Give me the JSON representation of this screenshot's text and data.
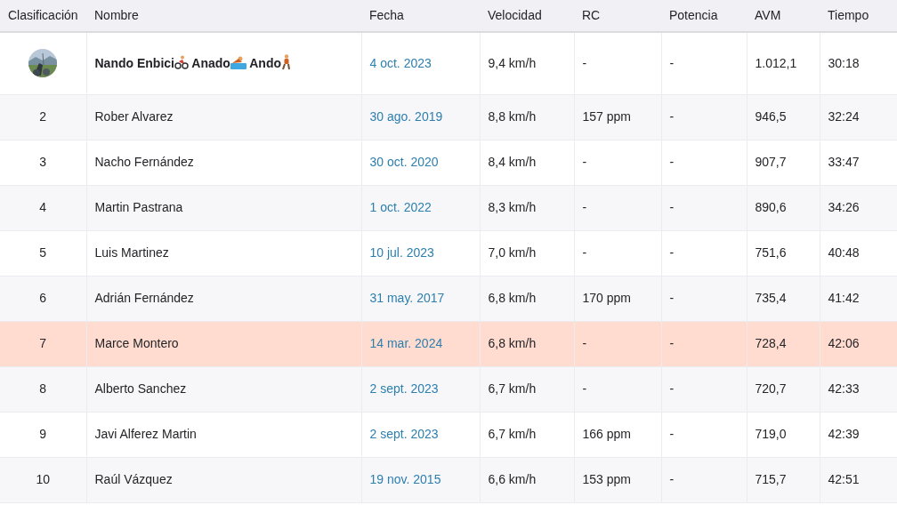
{
  "table": {
    "columns": [
      "Clasificación",
      "Nombre",
      "Fecha",
      "Velocidad",
      "RC",
      "Potencia",
      "AVM",
      "Tiempo"
    ],
    "rows": [
      {
        "name_parts": [
          "Nando Enbici",
          " Anado",
          " Ando"
        ],
        "date": "4 oct. 2023",
        "speed": "9,4 km/h",
        "rc": "-",
        "power": "-",
        "avm": "1.012,1",
        "time": "30:18",
        "highlighted": false
      },
      {
        "rank": "2",
        "name": "Rober Alvarez",
        "date": "30 ago. 2019",
        "speed": "8,8 km/h",
        "rc": "157 ppm",
        "power": "-",
        "avm": "946,5",
        "time": "32:24",
        "highlighted": false
      },
      {
        "rank": "3",
        "name": "Nacho Fernández",
        "date": "30 oct. 2020",
        "speed": "8,4 km/h",
        "rc": "-",
        "power": "-",
        "avm": "907,7",
        "time": "33:47",
        "highlighted": false
      },
      {
        "rank": "4",
        "name": "Martin Pastrana",
        "date": "1 oct. 2022",
        "speed": "8,3 km/h",
        "rc": "-",
        "power": "-",
        "avm": "890,6",
        "time": "34:26",
        "highlighted": false
      },
      {
        "rank": "5",
        "name": "Luis Martinez",
        "date": "10 jul. 2023",
        "speed": "7,0 km/h",
        "rc": "-",
        "power": "-",
        "avm": "751,6",
        "time": "40:48",
        "highlighted": false
      },
      {
        "rank": "6",
        "name": "Adrián Fernández",
        "date": "31 may. 2017",
        "speed": "6,8 km/h",
        "rc": "170 ppm",
        "power": "-",
        "avm": "735,4",
        "time": "41:42",
        "highlighted": false
      },
      {
        "rank": "7",
        "name": "Marce Montero",
        "date": "14 mar. 2024",
        "speed": "6,8 km/h",
        "rc": "-",
        "power": "-",
        "avm": "728,4",
        "time": "42:06",
        "highlighted": true
      },
      {
        "rank": "8",
        "name": "Alberto Sanchez",
        "date": "2 sept. 2023",
        "speed": "6,7 km/h",
        "rc": "-",
        "power": "-",
        "avm": "720,7",
        "time": "42:33",
        "highlighted": false
      },
      {
        "rank": "9",
        "name": "Javi Alferez Martin",
        "date": "2 sept. 2023",
        "speed": "6,7 km/h",
        "rc": "166 ppm",
        "power": "-",
        "avm": "719,0",
        "time": "42:39",
        "highlighted": false
      },
      {
        "rank": "10",
        "name": "Raúl Vázquez",
        "date": "19 nov. 2015",
        "speed": "6,6 km/h",
        "rc": "153 ppm",
        "power": "-",
        "avm": "715,7",
        "time": "42:51",
        "highlighted": false
      }
    ]
  }
}
